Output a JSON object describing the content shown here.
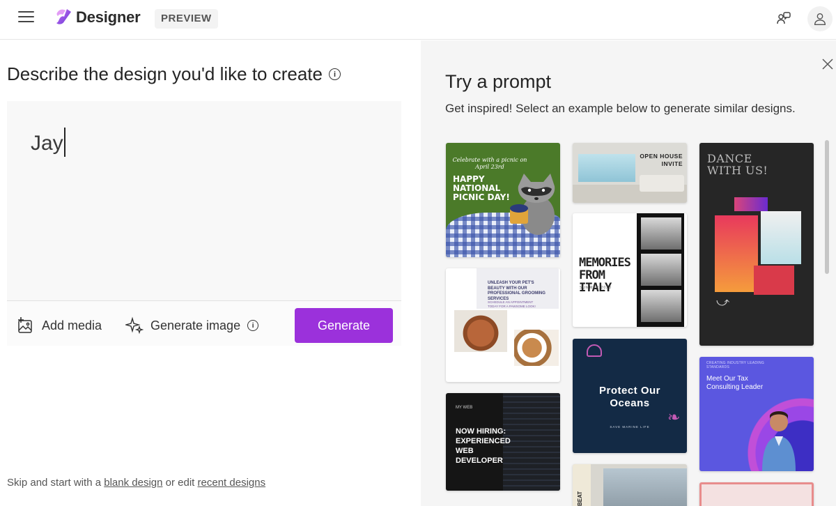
{
  "header": {
    "brand": "Designer",
    "preview_badge": "PREVIEW"
  },
  "left": {
    "heading": "Describe the design you'd like to create",
    "prompt_value": "Jay",
    "add_media": "Add media",
    "generate_image": "Generate image",
    "generate_button": "Generate",
    "skip_prefix": "Skip and start with a",
    "blank_design": "blank design",
    "skip_middle": "or edit",
    "recent_designs": "recent designs"
  },
  "right": {
    "title": "Try a prompt",
    "subtitle": "Get inspired! Select an example below to generate similar designs.",
    "cards": {
      "picnic_script": "Celebrate with a picnic on April 23rd",
      "picnic_title": "HAPPY NATIONAL PICNIC DAY!",
      "open_house": "OPEN HOUSE INVITE",
      "dance": "DANCE WITH US!",
      "pets_title": "UNLEASH YOUR PET'S BEAUTY WITH OUR PROFESSIONAL GROOMING SERVICES",
      "pets_sub": "SCHEDULE AN APPOINTMENT TODAY FOR A PAWSOME LOOK!",
      "italy_title": "MEMORIES FROM ITALY",
      "italy_sub": "SUMMER 2023",
      "ocean_title": "Protect Our Oceans",
      "ocean_sub": "SAVE MARINE LIFE",
      "tax_small": "CREATING INDUSTRY LEADING STANDARDS",
      "tax_title": "Meet Our Tax Consulting Leader",
      "hiring_small": "MY WEB",
      "hiring_title": "NOW HIRING: EXPERIENCED WEB DEVELOPER",
      "beat": "BEAT"
    }
  },
  "colors": {
    "accent": "#9b31db",
    "right_panel_bg": "#f5f5f5"
  },
  "icons": [
    "menu-icon",
    "designer-logo-icon",
    "community-icon",
    "account-icon",
    "info-icon",
    "add-media-icon",
    "sparkle-icon",
    "close-icon"
  ]
}
